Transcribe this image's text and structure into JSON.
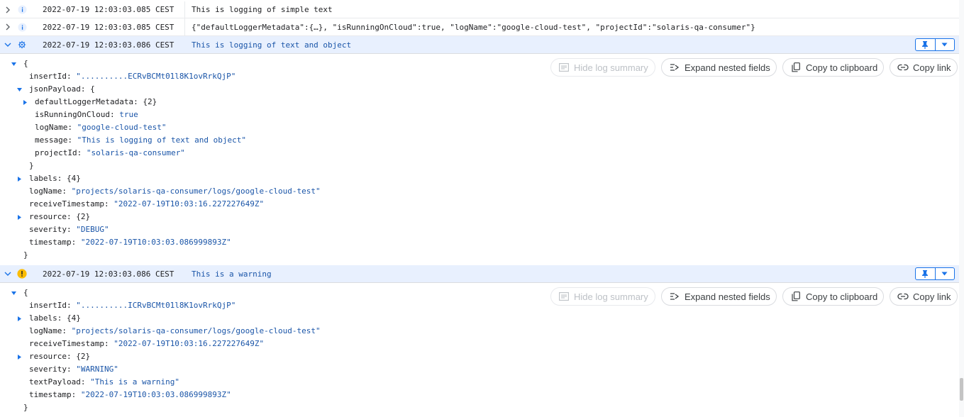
{
  "rows": [
    {
      "timestamp": "2022-07-19 12:03:03.085 CEST",
      "message": "This is logging of simple text",
      "severity_icon": "info-icon"
    },
    {
      "timestamp": "2022-07-19 12:03:03.085 CEST",
      "message": "{\"defaultLoggerMetadata\":{…}, \"isRunningOnCloud\":true, \"logName\":\"google-cloud-test\", \"projectId\":\"solaris-qa-consumer\"}",
      "severity_icon": "info-icon"
    }
  ],
  "entry1": {
    "timestamp": "2022-07-19 12:03:03.086 CEST",
    "message": "This is logging of text and object",
    "severity_icon": "debug-icon",
    "open_brace": "{",
    "close_brace": "}",
    "inner_close": "}",
    "insertId_key": "insertId:",
    "insertId_val": "\"..........ECRvBCMt01l8K1ovRrkQjP\"",
    "jsonPayload_key": "jsonPayload: {",
    "defaultLoggerMetadata": "defaultLoggerMetadata: {2}",
    "isRunningOnCloud_key": "isRunningOnCloud:",
    "isRunningOnCloud_val": "true",
    "logName_inner_key": "logName:",
    "logName_inner_val": "\"google-cloud-test\"",
    "message_key": "message:",
    "message_val": "\"This is logging of text and object\"",
    "projectId_key": "projectId:",
    "projectId_val": "\"solaris-qa-consumer\"",
    "labels": "labels: {4}",
    "logName_key": "logName:",
    "logName_val": "\"projects/solaris-qa-consumer/logs/google-cloud-test\"",
    "receiveTimestamp_key": "receiveTimestamp:",
    "receiveTimestamp_val": "\"2022-07-19T10:03:16.227227649Z\"",
    "resource": "resource: {2}",
    "severity_key": "severity:",
    "severity_val": "\"DEBUG\"",
    "timestamp_key": "timestamp:",
    "timestamp_val": "\"2022-07-19T10:03:03.086999893Z\""
  },
  "entry2": {
    "timestamp": "2022-07-19 12:03:03.086 CEST",
    "message": "This is a warning",
    "severity_icon": "warning-icon",
    "open_brace": "{",
    "close_brace": "}",
    "insertId_key": "insertId:",
    "insertId_val": "\"..........ICRvBCMt01l8K1ovRrkQjP\"",
    "labels": "labels: {4}",
    "logName_key": "logName:",
    "logName_val": "\"projects/solaris-qa-consumer/logs/google-cloud-test\"",
    "receiveTimestamp_key": "receiveTimestamp:",
    "receiveTimestamp_val": "\"2022-07-19T10:03:16.227227649Z\"",
    "resource": "resource: {2}",
    "severity_key": "severity:",
    "severity_val": "\"WARNING\"",
    "textPayload_key": "textPayload:",
    "textPayload_val": "\"This is a warning\"",
    "timestamp_key": "timestamp:",
    "timestamp_val": "\"2022-07-19T10:03:03.086999893Z\""
  },
  "actions": {
    "hide_summary": "Hide log summary",
    "expand_nested": "Expand nested fields",
    "copy_clipboard": "Copy to clipboard",
    "copy_link": "Copy link"
  },
  "colors": {
    "accent": "#1a73e8",
    "string_value": "#1a55a8",
    "expanded_row_bg": "#e8f0fe",
    "warning": "#fbbc04"
  }
}
